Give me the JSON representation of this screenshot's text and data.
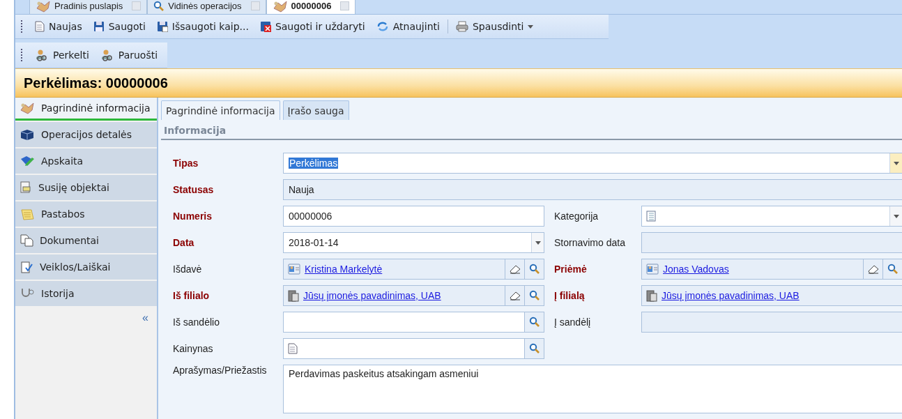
{
  "document_tabs": [
    {
      "label": "Pradinis puslapis",
      "selected": false
    },
    {
      "label": "Vidinės operacijos",
      "selected": false
    },
    {
      "label": "00000006",
      "selected": true
    }
  ],
  "toolbar": [
    {
      "label": "Naujas",
      "dropdown": false
    },
    {
      "label": "Saugoti",
      "dropdown": false
    },
    {
      "label": "Išsaugoti kaip...",
      "dropdown": false
    },
    {
      "label": "Saugoti ir uždaryti",
      "dropdown": false
    },
    {
      "label": "Atnaujinti",
      "dropdown": false
    },
    {
      "label": "Spausdinti",
      "dropdown": true
    }
  ],
  "action_toolbar": [
    {
      "label": "Perkelti"
    },
    {
      "label": "Paruošti"
    }
  ],
  "header": {
    "title": "Perkėlimas: 00000006"
  },
  "sidebar": {
    "items": [
      {
        "label": "Pagrindinė informacija",
        "selected": true
      },
      {
        "label": "Operacijos detalės",
        "selected": false
      },
      {
        "label": "Apskaita",
        "selected": false
      },
      {
        "label": "Susiję objektai",
        "selected": false
      },
      {
        "label": "Pastabos",
        "selected": false
      },
      {
        "label": "Dokumentai",
        "selected": false
      },
      {
        "label": "Veiklos/Laiškai",
        "selected": false
      },
      {
        "label": "Istorija",
        "selected": false
      }
    ],
    "collapse": "«"
  },
  "content_tabs": [
    {
      "label": "Pagrindinė informacija",
      "selected": true
    },
    {
      "label": "Įrašo sauga",
      "selected": false
    }
  ],
  "section": {
    "title": "Informacija"
  },
  "form_rows": [
    {
      "cells": [
        {
          "label": "Tipas",
          "required": true,
          "kind": "combo",
          "wide": true,
          "value": "Perkėlimas",
          "value_selected": true
        }
      ]
    },
    {
      "cells": [
        {
          "label": "Statusas",
          "required": true,
          "kind": "readonly",
          "wide": true,
          "value": "Nauja"
        }
      ]
    },
    {
      "cells": [
        {
          "label": "Numeris",
          "required": true,
          "kind": "text",
          "value": "00000006"
        },
        {
          "label": "Kategorija",
          "required": false,
          "kind": "category"
        }
      ]
    },
    {
      "cells": [
        {
          "label": "Data",
          "required": true,
          "kind": "date",
          "value": "2018-01-14"
        },
        {
          "label": "Stornavimo data",
          "required": false,
          "kind": "readonly"
        }
      ]
    },
    {
      "cells": [
        {
          "label": "Išdavė",
          "required": false,
          "kind": "person",
          "value": "Kristina Markelytė",
          "clear_button": true,
          "search_button": true
        },
        {
          "label": "Priėmė",
          "required": true,
          "kind": "person",
          "value": "Jonas Vadovas",
          "clear_button": true,
          "search_button": true
        }
      ]
    },
    {
      "cells": [
        {
          "label": "Iš filialo",
          "required": true,
          "kind": "branch",
          "value": "Jūsų įmonės pavadinimas, UAB",
          "clear_button": true,
          "search_button": true
        },
        {
          "label": "Į filialą",
          "required": true,
          "kind": "branch",
          "value": "Jūsų įmonės pavadinimas, UAB",
          "clear_button": false,
          "search_button": false
        }
      ]
    },
    {
      "cells": [
        {
          "label": "Iš sandėlio",
          "required": false,
          "kind": "lookup",
          "search_button": true
        },
        {
          "label": "Į sandėlį",
          "required": false,
          "kind": "readonly"
        }
      ]
    },
    {
      "cells": [
        {
          "label": "Kainynas",
          "required": false,
          "kind": "pricelist",
          "search_button": true
        }
      ]
    },
    {
      "cells": [
        {
          "label": "Aprašymas/Priežastis",
          "required": false,
          "kind": "memo",
          "wide": true,
          "value": "Perdavimas paskeitus atsakingam asmeniui"
        }
      ]
    }
  ]
}
